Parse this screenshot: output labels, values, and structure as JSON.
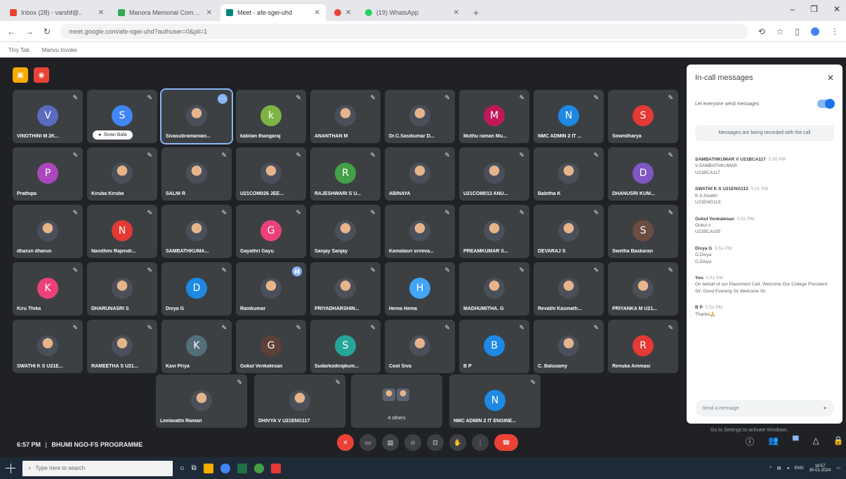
{
  "browser": {
    "tabs": [
      {
        "title": "Inbox (28) - varshf@..",
        "color": "#ea4335"
      },
      {
        "title": "Manora Memorial Computer Ap..",
        "color": "#34a853"
      },
      {
        "title": "Meet - afe-sgei-uhd",
        "color": "#00897b"
      },
      {
        "title": "",
        "color": "#ea4335"
      },
      {
        "title": "(19) WhatsApp",
        "color": "#25d366"
      }
    ],
    "url": "meet.google.com/afe-sgei-uhd?authuser=0&pli=1",
    "bookmarks": [
      "Tiny Tab",
      "Manvu Invoke"
    ]
  },
  "tiles": [
    {
      "name": "VINOTHINI M 2K...",
      "initial": "V",
      "color": "#5c6bc0"
    },
    {
      "name": "",
      "initial": "S",
      "color": "#4285f4",
      "pill": "Sivan Bala"
    },
    {
      "name": "Sivasubramanian...",
      "initial": "",
      "color": "",
      "photo": true,
      "speaking": true
    },
    {
      "name": "kabilan thangaraj",
      "initial": "k",
      "color": "#7cb342"
    },
    {
      "name": "ANANTHAN M",
      "initial": "",
      "color": "",
      "photo": true
    },
    {
      "name": "Dr.C.Sasikumar D...",
      "initial": "",
      "color": "",
      "photo": true
    },
    {
      "name": "Muthu raman Mu...",
      "initial": "M",
      "color": "#c2185b"
    },
    {
      "name": "NMC ADMIN 2 IT ...",
      "initial": "N",
      "color": "#1e88e5"
    },
    {
      "name": "Sowndharya",
      "initial": "S",
      "color": "#e53935"
    },
    {
      "name": "Prathipa",
      "initial": "P",
      "color": "#ab47bc"
    },
    {
      "name": "Kiruba Kiruba",
      "initial": "",
      "color": "",
      "photo": true
    },
    {
      "name": "SALNI R",
      "initial": "",
      "color": "",
      "photo": true
    },
    {
      "name": "U21COM026 JEE...",
      "initial": "",
      "color": "",
      "photo": true
    },
    {
      "name": "RAJESHWARI S U...",
      "initial": "R",
      "color": "#43a047"
    },
    {
      "name": "ABINAYA",
      "initial": "",
      "color": "",
      "photo": true
    },
    {
      "name": "U21COM013 ANU...",
      "initial": "",
      "color": "",
      "photo": true
    },
    {
      "name": "Babitha K",
      "initial": "",
      "color": "",
      "photo": true
    },
    {
      "name": "DHANUSRI KUM...",
      "initial": "D",
      "color": "#7e57c2"
    },
    {
      "name": "dharun dharun",
      "initial": "",
      "color": "",
      "photo": true
    },
    {
      "name": "Nandhini Rajendr...",
      "initial": "N",
      "color": "#e53935"
    },
    {
      "name": "SAMBATHKUMA...",
      "initial": "",
      "color": "",
      "photo": true
    },
    {
      "name": "Gayathri Gayu",
      "initial": "G",
      "color": "#ec407a"
    },
    {
      "name": "Sanjay Sanjay",
      "initial": "",
      "color": "",
      "photo": true
    },
    {
      "name": "Kamalasri sriniva...",
      "initial": "",
      "color": "",
      "photo": true
    },
    {
      "name": "PREAMKUMAR S...",
      "initial": "",
      "color": "",
      "photo": true
    },
    {
      "name": "DEVARAJ S",
      "initial": "",
      "color": "",
      "photo": true
    },
    {
      "name": "Swetha Baskaran",
      "initial": "S",
      "color": "#6d4c41"
    },
    {
      "name": "Kiru Thika",
      "initial": "K",
      "color": "#ec407a"
    },
    {
      "name": "DHARUNASRI S",
      "initial": "",
      "color": "",
      "photo": true
    },
    {
      "name": "Divya G",
      "initial": "D",
      "color": "#1e88e5"
    },
    {
      "name": "Ramkumar",
      "initial": "",
      "color": "",
      "photo": true,
      "badge": true
    },
    {
      "name": "PRIYADHARSHIN...",
      "initial": "",
      "color": "",
      "photo": true
    },
    {
      "name": "Hema Hema",
      "initial": "H",
      "color": "#42a5f5"
    },
    {
      "name": "MADHUMITHA. G",
      "initial": "",
      "color": "",
      "photo": true
    },
    {
      "name": "Revathi Kasinath...",
      "initial": "",
      "color": "",
      "photo": true
    },
    {
      "name": "PRIYANKA M U21...",
      "initial": "",
      "color": "",
      "photo": true
    },
    {
      "name": "SWATHI K S U21E...",
      "initial": "",
      "color": "",
      "photo": true
    },
    {
      "name": "RAMEETHA S U21...",
      "initial": "",
      "color": "",
      "photo": true
    },
    {
      "name": "Kavi Priya",
      "initial": "K",
      "color": "#546e7a"
    },
    {
      "name": "Gokul Venkatesan",
      "initial": "G",
      "color": "#5d4037"
    },
    {
      "name": "Sudarkodirajkum...",
      "initial": "S",
      "color": "#26a69a"
    },
    {
      "name": "Cool Siva",
      "initial": "",
      "color": "",
      "photo": true
    },
    {
      "name": "B P",
      "initial": "B",
      "color": "#1e88e5"
    },
    {
      "name": "C. Balusamy",
      "initial": "",
      "color": "",
      "photo": true
    },
    {
      "name": "Renuka Ammasi",
      "initial": "R",
      "color": "#e53935"
    }
  ],
  "bottom_tiles": [
    {
      "name": "Leelavathi Raman",
      "initial": "",
      "photo": true
    },
    {
      "name": "DHIVYA V U21ENG117",
      "initial": "",
      "photo": true
    },
    {
      "name": "4 others",
      "initial": "",
      "others": true
    },
    {
      "name": "NMC ADMIN 2 IT ENGINE...",
      "initial": "N",
      "color": "#1e88e5"
    }
  ],
  "panel": {
    "title": "In-call messages",
    "toggle_label": "Let everyone send messages",
    "recording_note": "Messages are being recorded with the call",
    "messages": [
      {
        "sender": "SAMBATHKUMAR V U21BCA117",
        "time": "5:50 PM",
        "lines": [
          "V.SAMBATHKUMAR",
          "U21BCA117"
        ]
      },
      {
        "sender": "SWATHI K S U21ENG113",
        "time": "5:51 PM",
        "lines": [
          "K.S.Swathi",
          "U21ENG113"
        ]
      },
      {
        "sender": "Gokul Venkatesan",
        "time": "5:51 PM",
        "lines": [
          "Gokul.v",
          "U21BCA105"
        ]
      },
      {
        "sender": "Divya G",
        "time": "5:51 PM",
        "lines": [
          "G.Divya",
          "G.Divya"
        ]
      },
      {
        "sender": "You",
        "time": "5:51 PM",
        "lines": [
          "On behalf of our Placement Cell, Welcome Our College President Sir, Good Evening Sir Welcome Sir"
        ]
      },
      {
        "sender": "B P",
        "time": "5:52 PM",
        "lines": [
          "Thanks🙏"
        ]
      }
    ],
    "send_placeholder": "Send a message"
  },
  "meeting": {
    "time": "6:57 PM",
    "separator": "|",
    "title": "BHUMI NGO-FS PROGRAMME"
  },
  "activation_text": "Go to Settings to activate Windows.",
  "taskbar": {
    "search_placeholder": "Type here to search",
    "lang": "ENG",
    "clock": "18:57",
    "date": "30-01-2024"
  }
}
